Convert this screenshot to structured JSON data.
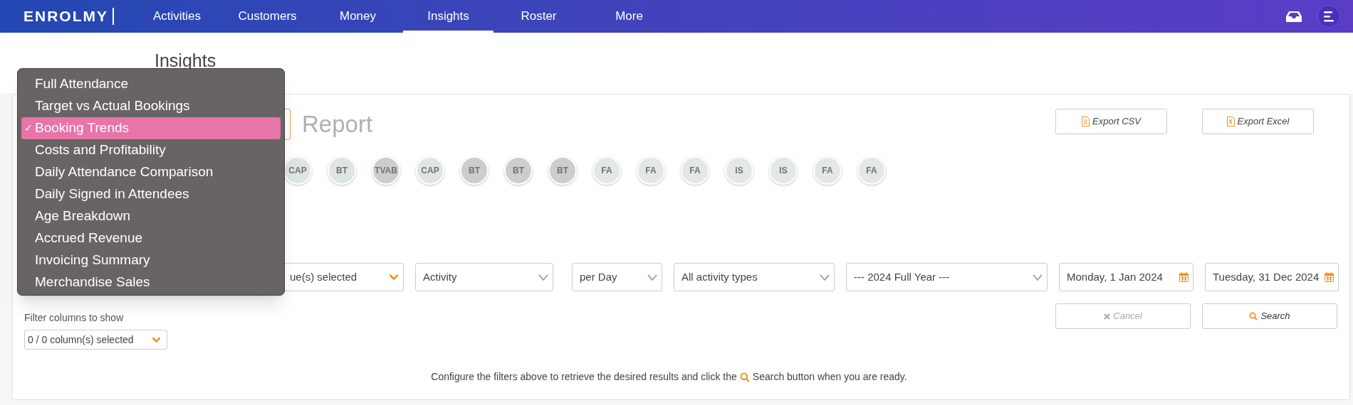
{
  "nav": {
    "logo": "ENROLMY",
    "items": [
      {
        "label": "Activities",
        "selected": false
      },
      {
        "label": "Customers",
        "selected": false
      },
      {
        "label": "Money",
        "selected": false
      },
      {
        "label": "Insights",
        "selected": true
      },
      {
        "label": "Roster",
        "selected": false
      },
      {
        "label": "More",
        "selected": false
      }
    ]
  },
  "page_title": "Insights",
  "report_type_menu": {
    "check": "✓",
    "items": [
      {
        "label": "Full Attendance",
        "selected": false
      },
      {
        "label": "Target vs Actual Bookings",
        "selected": false
      },
      {
        "label": "Booking Trends",
        "selected": true
      },
      {
        "label": "Costs and Profitability",
        "selected": false
      },
      {
        "label": "Daily Attendance Comparison",
        "selected": false
      },
      {
        "label": "Daily Signed in Attendees",
        "selected": false
      },
      {
        "label": "Age Breakdown",
        "selected": false
      },
      {
        "label": "Accrued Revenue",
        "selected": false
      },
      {
        "label": "Invoicing Summary",
        "selected": false
      },
      {
        "label": "Merchandise Sales",
        "selected": false
      }
    ]
  },
  "report_label": "Report",
  "export_buttons": [
    {
      "label": "Export CSV",
      "kind": "csv"
    },
    {
      "label": "Export Excel",
      "kind": "excel"
    }
  ],
  "report_chips": [
    {
      "label": "CAP",
      "color": "#dfe5e0"
    },
    {
      "label": "BT",
      "color": "#dfe5e0"
    },
    {
      "label": "TVAB",
      "color": "#cdcdcd"
    },
    {
      "label": "CAP",
      "color": "#dfe5e0"
    },
    {
      "label": "BT",
      "color": "#cdcdcd"
    },
    {
      "label": "BT",
      "color": "#cdcdcd"
    },
    {
      "label": "BT",
      "color": "#cdcdcd"
    },
    {
      "label": "FA",
      "color": "#e3e8e4"
    },
    {
      "label": "FA",
      "color": "#e3e8e4"
    },
    {
      "label": "FA",
      "color": "#e3e8e4"
    },
    {
      "label": "IS",
      "color": "#e3e8e4"
    },
    {
      "label": "IS",
      "color": "#e3e8e4"
    },
    {
      "label": "FA",
      "color": "#e3e8e4"
    },
    {
      "label": "FA",
      "color": "#e3e8e4"
    }
  ],
  "filters": [
    {
      "value": "ue(s) selected",
      "kind": "multiselect"
    },
    {
      "value": "Activity",
      "kind": "select"
    },
    {
      "value": "per Day",
      "kind": "select"
    },
    {
      "value": "All activity types",
      "kind": "select"
    },
    {
      "value": "--- 2024 Full Year ---",
      "kind": "select"
    },
    {
      "value": "Monday, 1 Jan 2024",
      "kind": "date"
    },
    {
      "value": "Tuesday, 31 Dec 2024",
      "kind": "date"
    }
  ],
  "column_filter": {
    "label": "Filter columns to show",
    "value": "0 / 0 column(s) selected"
  },
  "actions": [
    {
      "label": "Cancel",
      "kind": "cancel",
      "disabled": true
    },
    {
      "label": "Search",
      "kind": "search",
      "disabled": false
    }
  ],
  "hint": {
    "before": "Configure the filters above to retrieve the desired results and click the",
    "after": "Search button when you are ready."
  }
}
